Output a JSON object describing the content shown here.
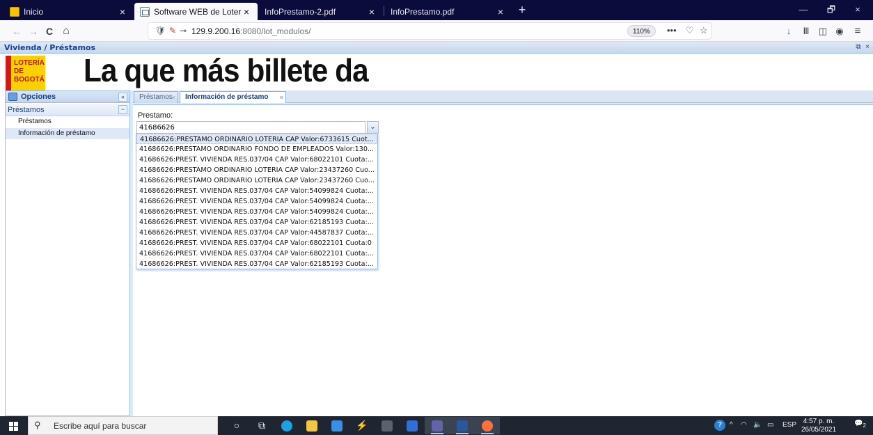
{
  "browser": {
    "tabs": [
      {
        "label": "Inicio",
        "active": false
      },
      {
        "label": "Software WEB de Loterias",
        "active": true
      },
      {
        "label": "InfoPrestamo-2.pdf",
        "active": false
      },
      {
        "label": "InfoPrestamo.pdf",
        "active": false
      }
    ],
    "close_glyph": "×",
    "new_tab_glyph": "+",
    "window_controls": {
      "minimize": "—",
      "restore": "🗗",
      "close": "×"
    },
    "nav": {
      "back": "←",
      "forward": "→",
      "reload": "C",
      "home": "⌂"
    },
    "url": {
      "host": "129.9.200.16",
      "rest": ":8080/lot_modulos/"
    },
    "zoom": "110%",
    "url_actions": {
      "more": "•••",
      "pocket": "♡",
      "bookmark": "☆"
    },
    "toolbar_icons": {
      "download": "↓",
      "library": "Ⅲ",
      "sidebar": "◫",
      "account": "◉",
      "menu": "≡"
    }
  },
  "app": {
    "title": "Vivienda / Préstamos",
    "title_tools": {
      "restore": "⧉",
      "close": "×"
    },
    "logo_lines": [
      "LOTERÍA",
      "DE",
      "BOGOTÁ"
    ],
    "slogan": "La que más billete da",
    "west": {
      "title": "Opciones",
      "collapse_glyph": "«",
      "group": "Préstamos",
      "group_toggle": "−",
      "items": [
        {
          "label": "Préstamos",
          "selected": false
        },
        {
          "label": "Información de préstamo",
          "selected": true
        }
      ]
    },
    "center_tabs": [
      {
        "label": "Préstamos",
        "active": false
      },
      {
        "label": "Información de préstamo",
        "active": true
      }
    ],
    "tab_close_glyph": "×",
    "form": {
      "label": "Prestamo:",
      "value": "41686626",
      "trigger_glyph": "⌄",
      "options": [
        "41686626:PRESTAMO ORDINARIO LOTERIA CAP Valor:6733615 Cuot...",
        "41686626:PRESTAMO ORDINARIO FONDO DE EMPLEADOS Valor:130...",
        "41686626:PREST. VIVIENDA RES.037/04 CAP Valor:68022101 Cuota:...",
        "41686626:PRESTAMO ORDINARIO LOTERIA CAP Valor:23437260 Cuo...",
        "41686626:PRESTAMO ORDINARIO LOTERIA CAP Valor:23437260 Cuo...",
        "41686626:PREST. VIVIENDA RES.037/04 CAP Valor:54099824 Cuota:...",
        "41686626:PREST. VIVIENDA RES.037/04 CAP Valor:54099824 Cuota:...",
        "41686626:PREST. VIVIENDA RES.037/04 CAP Valor:54099824 Cuota:...",
        "41686626:PREST. VIVIENDA RES.037/04 CAP Valor:62185193 Cuota:...",
        "41686626:PREST. VIVIENDA RES.037/04 CAP Valor:44587837 Cuota:...",
        "41686626:PREST. VIVIENDA RES.037/04 CAP Valor:68022101 Cuota:0",
        "41686626:PREST. VIVIENDA RES.037/04 CAP Valor:68022101 Cuota:...",
        "41686626:PREST. VIVIENDA RES.037/04 CAP Valor:62185193 Cuota:..."
      ],
      "highlighted_index": 0
    }
  },
  "taskbar": {
    "search_placeholder": "Escribe aquí para buscar",
    "search_glyph": "⚲",
    "apps": [
      {
        "name": "cortana-icon",
        "glyph": "○"
      },
      {
        "name": "task-view-icon",
        "glyph": "⧉"
      },
      {
        "name": "edge-icon",
        "color": "#1fa0e0"
      },
      {
        "name": "file-explorer-icon",
        "color": "#f4c542"
      },
      {
        "name": "mail-icon",
        "color": "#3a8ee6"
      },
      {
        "name": "app-bolt-icon",
        "glyph": "⚡"
      },
      {
        "name": "calculator-icon",
        "color": "#5a6270"
      },
      {
        "name": "app-blue-icon",
        "color": "#2f6fd6"
      },
      {
        "name": "teams-icon",
        "color": "#6264a7"
      },
      {
        "name": "word-icon",
        "color": "#2b579a"
      },
      {
        "name": "firefox-icon",
        "color": "#ff7139"
      }
    ],
    "tray": {
      "help": "?",
      "chevron": "^",
      "lang": "ESP",
      "time": "4:57 p. m.",
      "date": "26/05/2021",
      "notifications": "2"
    }
  }
}
